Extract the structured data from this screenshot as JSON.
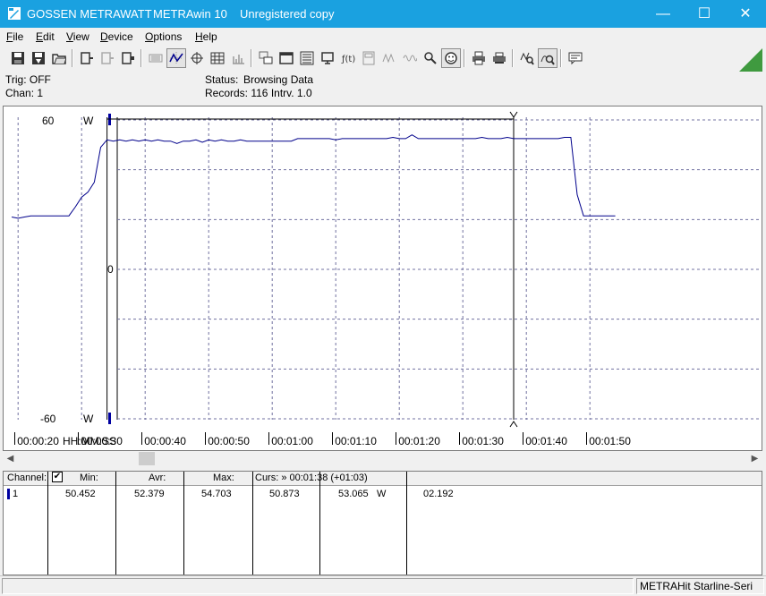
{
  "window": {
    "vendor": "GOSSEN METRAWATT",
    "app": "METRAwin 10",
    "license": "Unregistered copy",
    "minimize": "—",
    "maximize": "☐",
    "close": "✕"
  },
  "menu": [
    {
      "u": "F",
      "rest": "ile"
    },
    {
      "u": "E",
      "rest": "dit"
    },
    {
      "u": "V",
      "rest": "iew"
    },
    {
      "u": "D",
      "rest": "evice"
    },
    {
      "u": "O",
      "rest": "ptions"
    },
    {
      "u": "H",
      "rest": "elp"
    }
  ],
  "status": {
    "trig": "Trig: OFF",
    "chan": "Chan:  1",
    "status_label": "Status:",
    "status_value": "Browsing Data",
    "records": "Records: 116  Intrv. 1.0"
  },
  "chart_data": {
    "type": "line",
    "xlabel": "HH:MM:SS",
    "x_ticks": [
      "00:00:20",
      "00:00:30",
      "00:00:40",
      "00:00:50",
      "00:01:00",
      "00:01:10",
      "00:01:20",
      "00:01:30",
      "00:01:40",
      "00:01:50"
    ],
    "unit": "W",
    "y_ticks": [
      60,
      0,
      -60
    ],
    "ylim": [
      -60,
      60
    ],
    "xlim_s": [
      19,
      126
    ],
    "grid": true,
    "cursor1_s": 34,
    "cursor2_s": 98,
    "series": [
      {
        "color": "#00008b",
        "x_s": [
          19,
          20,
          21,
          22,
          23,
          24,
          25,
          26,
          27,
          28,
          29,
          30,
          31,
          32,
          33,
          34,
          35,
          36,
          37,
          38,
          39,
          40,
          41,
          42,
          43,
          44,
          45,
          46,
          47,
          48,
          49,
          50,
          51,
          52,
          53,
          54,
          55,
          56,
          57,
          58,
          59,
          60,
          61,
          62,
          63,
          64,
          65,
          66,
          67,
          68,
          69,
          70,
          71,
          72,
          73,
          74,
          75,
          76,
          77,
          78,
          79,
          80,
          81,
          82,
          83,
          84,
          85,
          86,
          87,
          88,
          89,
          90,
          91,
          92,
          93,
          94,
          95,
          96,
          97,
          98,
          99,
          100,
          101,
          102,
          103,
          104,
          105,
          106,
          107,
          108,
          109,
          110,
          111,
          112,
          113,
          114
        ],
        "y": [
          21,
          20.5,
          21,
          21.5,
          21.5,
          21.5,
          21.5,
          21.5,
          21.5,
          21.5,
          25,
          29,
          31,
          35,
          49,
          52,
          51.5,
          52,
          51.5,
          52,
          51.5,
          52,
          51.5,
          52,
          51.5,
          51.5,
          50.5,
          51.5,
          51.5,
          52,
          51,
          52,
          51.5,
          52,
          51.5,
          51.5,
          52,
          51.5,
          51.5,
          51.5,
          51.5,
          51.5,
          51.5,
          51.5,
          51.5,
          52.5,
          52.5,
          52.5,
          52.5,
          52.5,
          52.5,
          52,
          52.5,
          52.5,
          52.5,
          52.5,
          52.5,
          52.5,
          52.5,
          52.5,
          53,
          52.5,
          52.5,
          54,
          52.5,
          52.5,
          52.5,
          52.5,
          52.5,
          52.5,
          52.5,
          52.5,
          52.5,
          52.5,
          53,
          52.5,
          52.5,
          52.5,
          53,
          52.5,
          52.5,
          52.5,
          52.5,
          52.5,
          52.5,
          52.5,
          52.5,
          53,
          53,
          30,
          21.5,
          21.5,
          21.5,
          21.5,
          21.5,
          21.5
        ]
      }
    ]
  },
  "table": {
    "headers": {
      "channel": "Channel:",
      "check": "✔",
      "min": "Min:",
      "avr": "Avr:",
      "max": "Max:",
      "curs": "Curs: » 00:01:38 (+01:03)"
    },
    "row": {
      "channel": "1",
      "min": "50.452",
      "avr": "52.379",
      "max": "54.703",
      "c1": "50.873",
      "c2": "53.065",
      "unit": "W",
      "diff": "02.192"
    }
  },
  "statusbar": {
    "device": "METRAHit Starline-Seri"
  },
  "colors": {
    "titlebar": "#1aa1e0",
    "trace": "#00008b",
    "grid": "#7070a0",
    "indicator": "#3f9a3f"
  },
  "icons": [
    "pencil-logo-icon",
    "save-icon",
    "save-as-icon",
    "open-icon",
    "device-read-icon",
    "device-write-icon",
    "device-config-icon",
    "keyboard-icon",
    "chart-trace-icon",
    "crosshair-icon",
    "table-icon",
    "bar-graph-icon",
    "tile-icon",
    "window-icon",
    "list-icon",
    "monitor-icon",
    "fx-icon",
    "meter-icon",
    "signal-icon",
    "wave-icon",
    "search-device-icon",
    "smiley-icon",
    "print-icon",
    "print-preview-icon",
    "zoom-chart-icon",
    "zoom-wave-icon",
    "message-icon"
  ]
}
